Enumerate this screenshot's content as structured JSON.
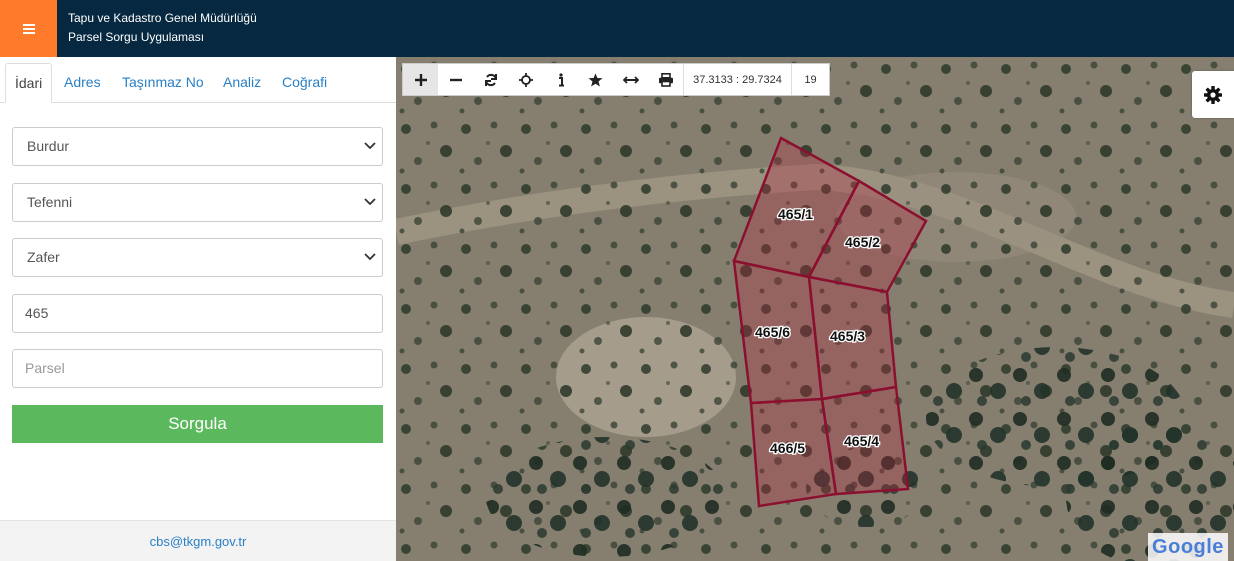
{
  "header": {
    "title_line1": "Tapu ve Kadastro Genel Müdürlüğü",
    "title_line2": "Parsel Sorgu Uygulaması",
    "menu_icon": "hamburger-icon",
    "accent_color": "#ff7a2a",
    "bg_color": "#062840"
  },
  "tabs": [
    "İdari",
    "Adres",
    "Taşınmaz No",
    "Analiz",
    "Coğrafi"
  ],
  "form": {
    "il": "Burdur",
    "ilce": "Tefenni",
    "mahalle": "Zafer",
    "ada": "465",
    "parsel_placeholder": "Parsel",
    "submit_label": "Sorgula"
  },
  "footer": {
    "email": "cbs@tkgm.gov.tr"
  },
  "toolbar": {
    "coords": "37.3133 : 29.7324",
    "zoom": "19",
    "icons": [
      "plus-icon",
      "minus-icon",
      "refresh-icon",
      "crosshair-icon",
      "info-icon",
      "star-icon",
      "measure-icon",
      "print-icon"
    ]
  },
  "map": {
    "parcels": [
      {
        "label": "465/1"
      },
      {
        "label": "465/2"
      },
      {
        "label": "465/6"
      },
      {
        "label": "465/3"
      },
      {
        "label": "466/5"
      },
      {
        "label": "465/4"
      }
    ],
    "attribution": "Google",
    "parcel_stroke_color": "#8b1030"
  }
}
